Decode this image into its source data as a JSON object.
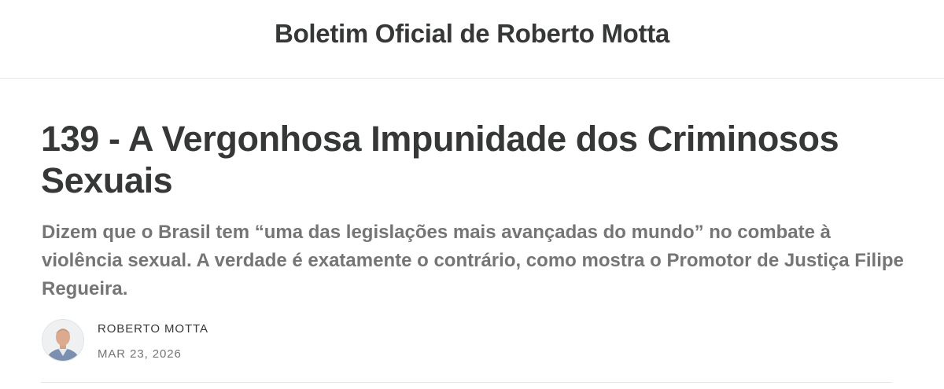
{
  "header": {
    "site_title": "Boletim Oficial de Roberto Motta"
  },
  "post": {
    "title": "139 - A Vergonhosa Impunidade dos Criminosos Sexuais",
    "subtitle": "Dizem que o Brasil tem “uma das legislações mais avançadas do mundo” no combate à violência sexual. A verdade é exatamente o contrário, como mostra o Promotor de Justiça Filipe Regueira.",
    "author": "ROBERTO MOTTA",
    "date": "MAR 23, 2026"
  },
  "colors": {
    "text_primary": "#363737",
    "text_secondary": "#757575",
    "divider": "#e6e6e6"
  }
}
